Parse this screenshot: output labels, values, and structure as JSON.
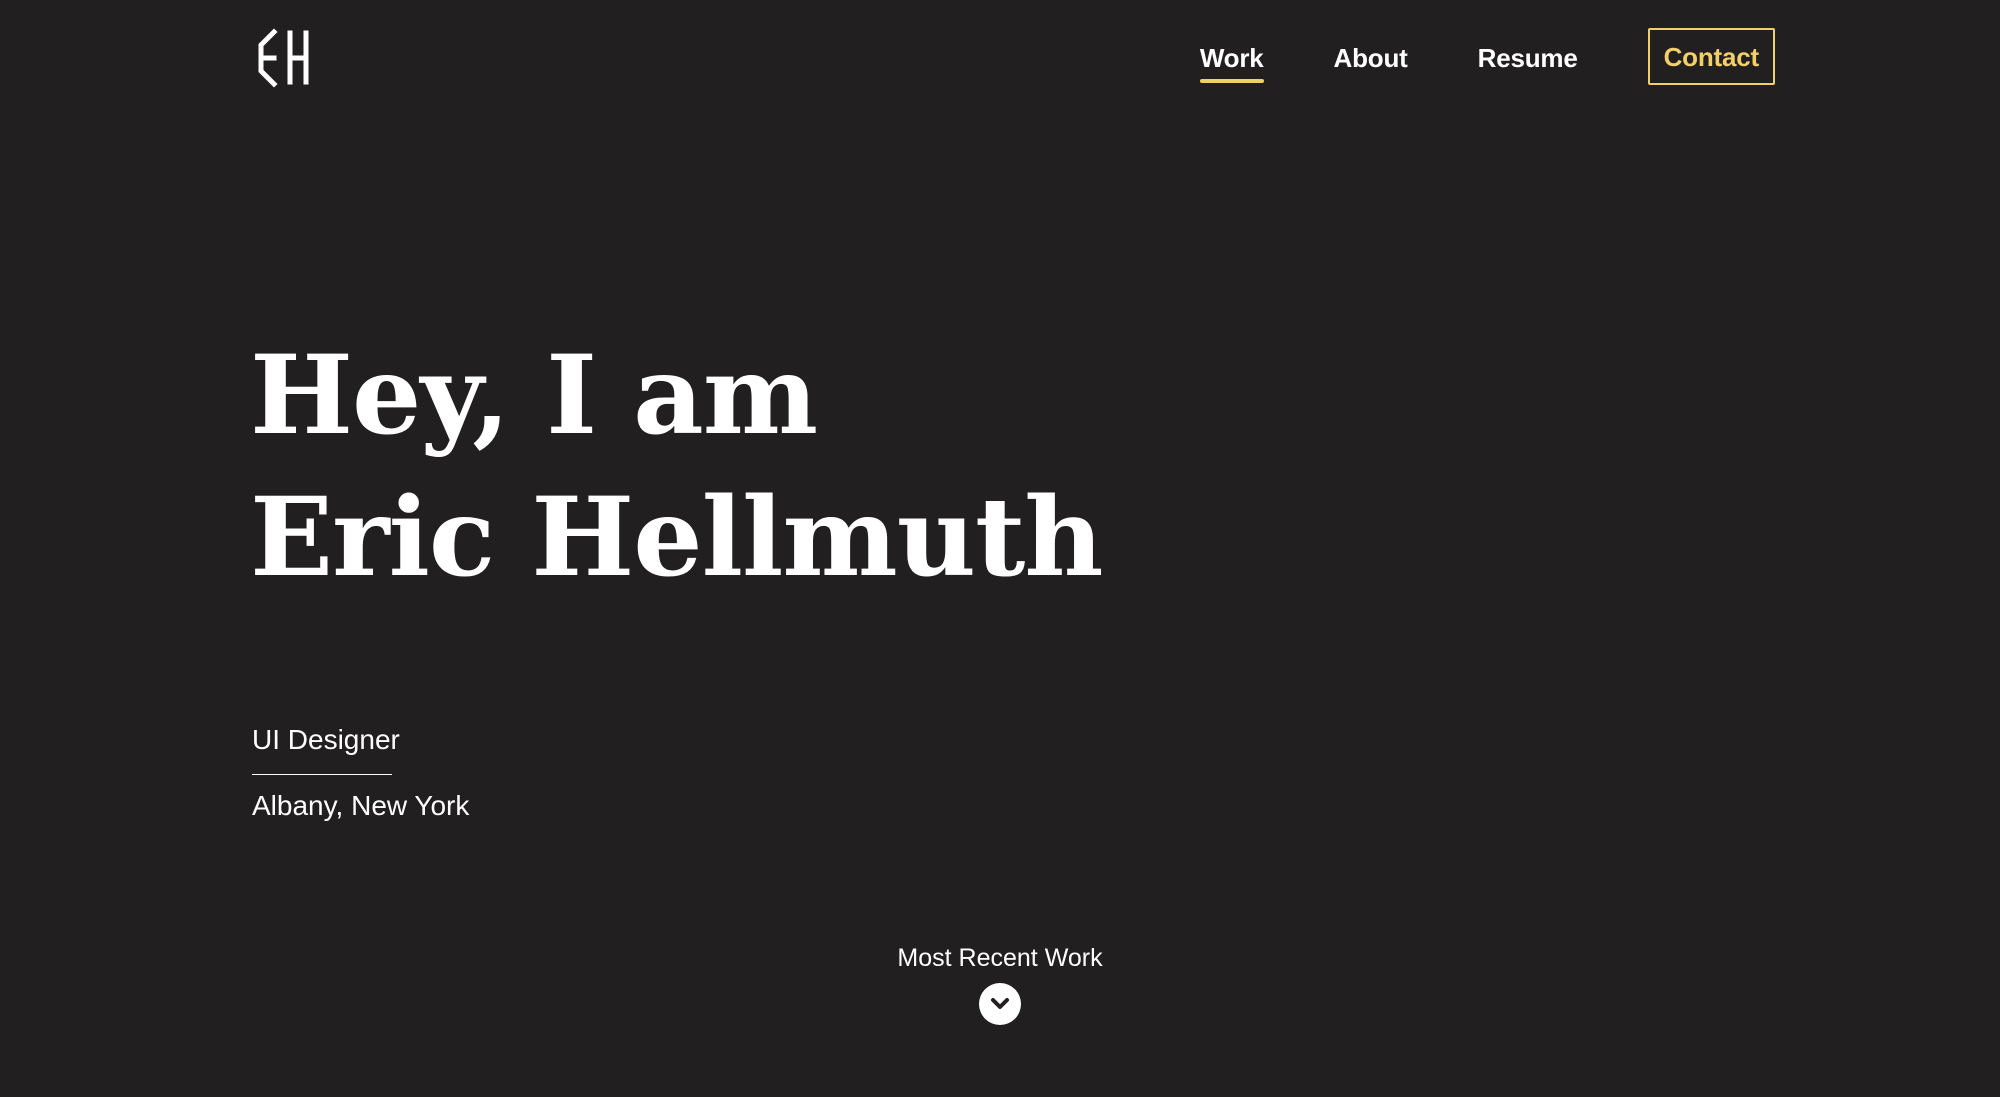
{
  "header": {
    "logo_text": "EH",
    "nav": [
      {
        "label": "Work",
        "active": true
      },
      {
        "label": "About",
        "active": false
      },
      {
        "label": "Resume",
        "active": false
      }
    ],
    "contact_label": "Contact"
  },
  "hero": {
    "line1": "Hey, I am",
    "line2": "Eric Hellmuth"
  },
  "profile": {
    "role": "UI Designer",
    "location": "Albany, New York"
  },
  "recent_work": {
    "label": "Most Recent Work",
    "icon": "chevron-down-icon"
  },
  "colors": {
    "background": "#221f20",
    "text": "#ffffff",
    "accent": "#f2d067"
  }
}
